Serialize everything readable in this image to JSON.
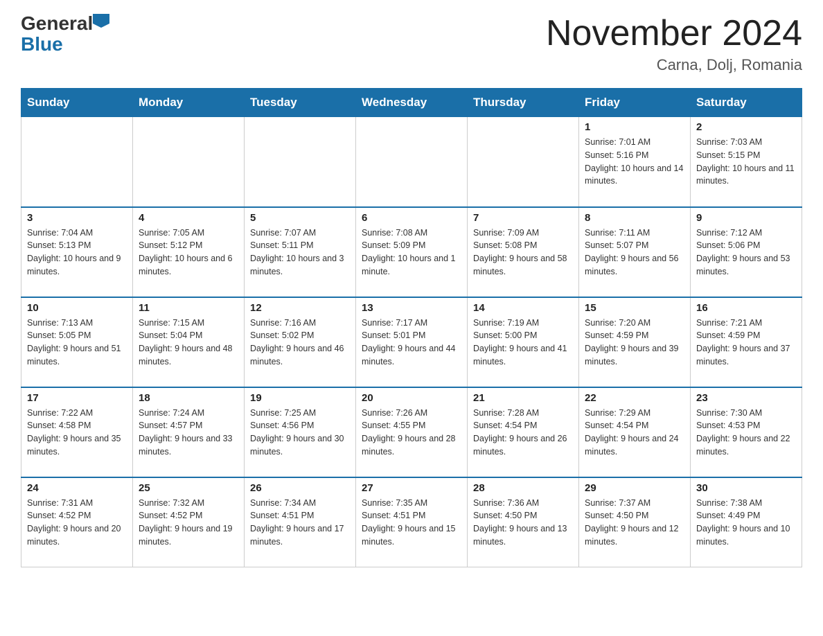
{
  "logo": {
    "general": "General",
    "blue": "Blue"
  },
  "title": "November 2024",
  "location": "Carna, Dolj, Romania",
  "days_of_week": [
    "Sunday",
    "Monday",
    "Tuesday",
    "Wednesday",
    "Thursday",
    "Friday",
    "Saturday"
  ],
  "weeks": [
    [
      {
        "day": "",
        "info": ""
      },
      {
        "day": "",
        "info": ""
      },
      {
        "day": "",
        "info": ""
      },
      {
        "day": "",
        "info": ""
      },
      {
        "day": "",
        "info": ""
      },
      {
        "day": "1",
        "info": "Sunrise: 7:01 AM\nSunset: 5:16 PM\nDaylight: 10 hours and 14 minutes."
      },
      {
        "day": "2",
        "info": "Sunrise: 7:03 AM\nSunset: 5:15 PM\nDaylight: 10 hours and 11 minutes."
      }
    ],
    [
      {
        "day": "3",
        "info": "Sunrise: 7:04 AM\nSunset: 5:13 PM\nDaylight: 10 hours and 9 minutes."
      },
      {
        "day": "4",
        "info": "Sunrise: 7:05 AM\nSunset: 5:12 PM\nDaylight: 10 hours and 6 minutes."
      },
      {
        "day": "5",
        "info": "Sunrise: 7:07 AM\nSunset: 5:11 PM\nDaylight: 10 hours and 3 minutes."
      },
      {
        "day": "6",
        "info": "Sunrise: 7:08 AM\nSunset: 5:09 PM\nDaylight: 10 hours and 1 minute."
      },
      {
        "day": "7",
        "info": "Sunrise: 7:09 AM\nSunset: 5:08 PM\nDaylight: 9 hours and 58 minutes."
      },
      {
        "day": "8",
        "info": "Sunrise: 7:11 AM\nSunset: 5:07 PM\nDaylight: 9 hours and 56 minutes."
      },
      {
        "day": "9",
        "info": "Sunrise: 7:12 AM\nSunset: 5:06 PM\nDaylight: 9 hours and 53 minutes."
      }
    ],
    [
      {
        "day": "10",
        "info": "Sunrise: 7:13 AM\nSunset: 5:05 PM\nDaylight: 9 hours and 51 minutes."
      },
      {
        "day": "11",
        "info": "Sunrise: 7:15 AM\nSunset: 5:04 PM\nDaylight: 9 hours and 48 minutes."
      },
      {
        "day": "12",
        "info": "Sunrise: 7:16 AM\nSunset: 5:02 PM\nDaylight: 9 hours and 46 minutes."
      },
      {
        "day": "13",
        "info": "Sunrise: 7:17 AM\nSunset: 5:01 PM\nDaylight: 9 hours and 44 minutes."
      },
      {
        "day": "14",
        "info": "Sunrise: 7:19 AM\nSunset: 5:00 PM\nDaylight: 9 hours and 41 minutes."
      },
      {
        "day": "15",
        "info": "Sunrise: 7:20 AM\nSunset: 4:59 PM\nDaylight: 9 hours and 39 minutes."
      },
      {
        "day": "16",
        "info": "Sunrise: 7:21 AM\nSunset: 4:59 PM\nDaylight: 9 hours and 37 minutes."
      }
    ],
    [
      {
        "day": "17",
        "info": "Sunrise: 7:22 AM\nSunset: 4:58 PM\nDaylight: 9 hours and 35 minutes."
      },
      {
        "day": "18",
        "info": "Sunrise: 7:24 AM\nSunset: 4:57 PM\nDaylight: 9 hours and 33 minutes."
      },
      {
        "day": "19",
        "info": "Sunrise: 7:25 AM\nSunset: 4:56 PM\nDaylight: 9 hours and 30 minutes."
      },
      {
        "day": "20",
        "info": "Sunrise: 7:26 AM\nSunset: 4:55 PM\nDaylight: 9 hours and 28 minutes."
      },
      {
        "day": "21",
        "info": "Sunrise: 7:28 AM\nSunset: 4:54 PM\nDaylight: 9 hours and 26 minutes."
      },
      {
        "day": "22",
        "info": "Sunrise: 7:29 AM\nSunset: 4:54 PM\nDaylight: 9 hours and 24 minutes."
      },
      {
        "day": "23",
        "info": "Sunrise: 7:30 AM\nSunset: 4:53 PM\nDaylight: 9 hours and 22 minutes."
      }
    ],
    [
      {
        "day": "24",
        "info": "Sunrise: 7:31 AM\nSunset: 4:52 PM\nDaylight: 9 hours and 20 minutes."
      },
      {
        "day": "25",
        "info": "Sunrise: 7:32 AM\nSunset: 4:52 PM\nDaylight: 9 hours and 19 minutes."
      },
      {
        "day": "26",
        "info": "Sunrise: 7:34 AM\nSunset: 4:51 PM\nDaylight: 9 hours and 17 minutes."
      },
      {
        "day": "27",
        "info": "Sunrise: 7:35 AM\nSunset: 4:51 PM\nDaylight: 9 hours and 15 minutes."
      },
      {
        "day": "28",
        "info": "Sunrise: 7:36 AM\nSunset: 4:50 PM\nDaylight: 9 hours and 13 minutes."
      },
      {
        "day": "29",
        "info": "Sunrise: 7:37 AM\nSunset: 4:50 PM\nDaylight: 9 hours and 12 minutes."
      },
      {
        "day": "30",
        "info": "Sunrise: 7:38 AM\nSunset: 4:49 PM\nDaylight: 9 hours and 10 minutes."
      }
    ]
  ]
}
